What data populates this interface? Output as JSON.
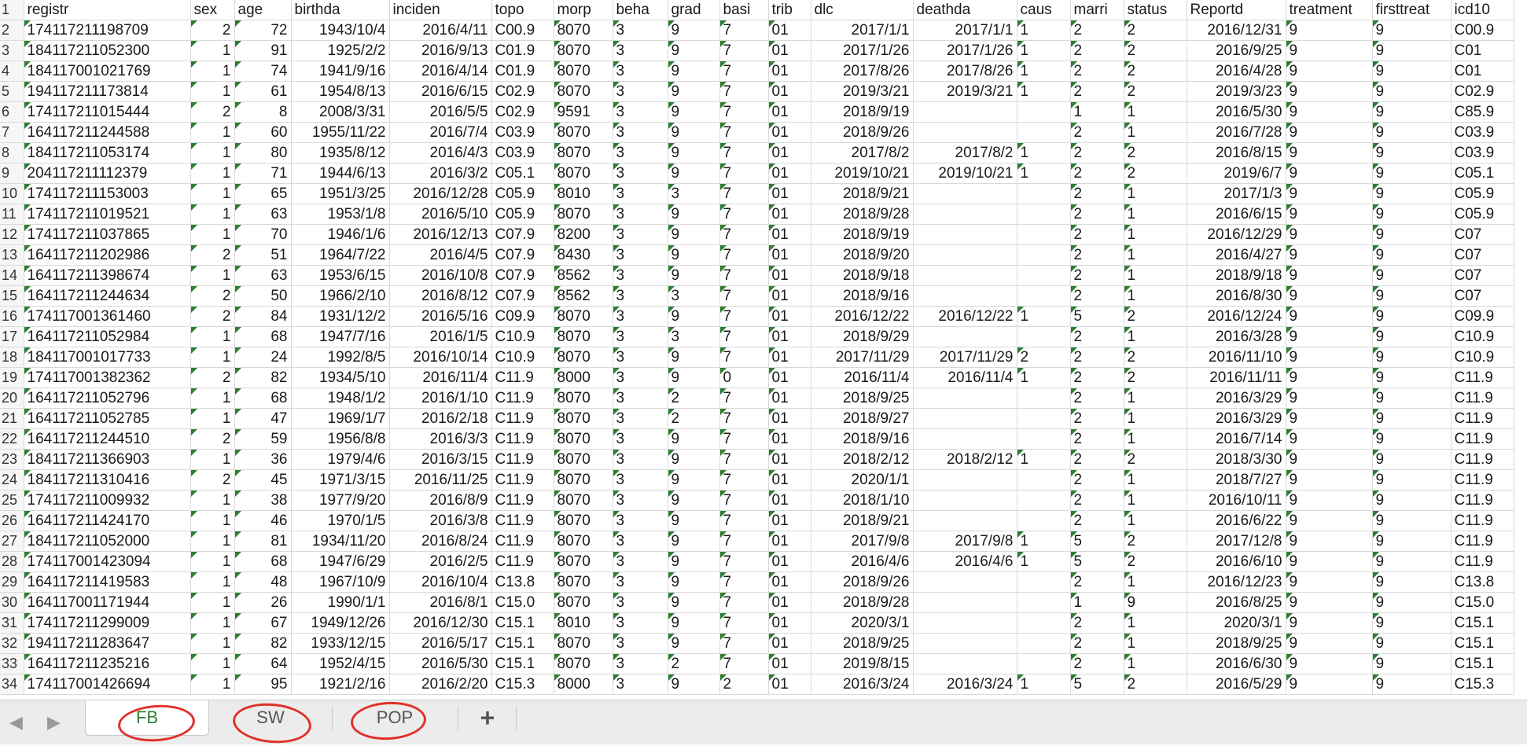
{
  "columns": [
    "registr",
    "sex",
    "age",
    "birthda",
    "inciden",
    "topo",
    "morp",
    "beha",
    "grad",
    "basi",
    "trib",
    "dlc",
    "deathda",
    "caus",
    "marri",
    "status",
    "Reportd",
    "treatment",
    "firsttreat",
    "icd10"
  ],
  "header_row_number": "1",
  "rows": [
    {
      "n": "2",
      "cells": [
        "174117211198709",
        "2",
        "72",
        "1943/10/4",
        "2016/4/11",
        "C00.9",
        "8070",
        "3",
        "9",
        "7",
        "01",
        "2017/1/1",
        "2017/1/1",
        "1",
        "2",
        "2",
        "2016/12/31",
        "9",
        "9",
        "C00.9"
      ]
    },
    {
      "n": "3",
      "cells": [
        "184117211052300",
        "1",
        "91",
        "1925/2/2",
        "2016/9/13",
        "C01.9",
        "8070",
        "3",
        "9",
        "7",
        "01",
        "2017/1/26",
        "2017/1/26",
        "1",
        "2",
        "2",
        "2016/9/25",
        "9",
        "9",
        "C01"
      ]
    },
    {
      "n": "4",
      "cells": [
        "184117001021769",
        "1",
        "74",
        "1941/9/16",
        "2016/4/14",
        "C01.9",
        "8070",
        "3",
        "9",
        "7",
        "01",
        "2017/8/26",
        "2017/8/26",
        "1",
        "2",
        "2",
        "2016/4/28",
        "9",
        "9",
        "C01"
      ]
    },
    {
      "n": "5",
      "cells": [
        "194117211173814",
        "1",
        "61",
        "1954/8/13",
        "2016/6/15",
        "C02.9",
        "8070",
        "3",
        "9",
        "7",
        "01",
        "2019/3/21",
        "2019/3/21",
        "1",
        "2",
        "2",
        "2019/3/23",
        "9",
        "9",
        "C02.9"
      ]
    },
    {
      "n": "6",
      "cells": [
        "174117211015444",
        "2",
        "8",
        "2008/3/31",
        "2016/5/5",
        "C02.9",
        "9591",
        "3",
        "9",
        "7",
        "01",
        "2018/9/19",
        "",
        "",
        "1",
        "1",
        "2016/5/30",
        "9",
        "9",
        "C85.9"
      ]
    },
    {
      "n": "7",
      "cells": [
        "164117211244588",
        "1",
        "60",
        "1955/11/22",
        "2016/7/4",
        "C03.9",
        "8070",
        "3",
        "9",
        "7",
        "01",
        "2018/9/26",
        "",
        "",
        "2",
        "1",
        "2016/7/28",
        "9",
        "9",
        "C03.9"
      ]
    },
    {
      "n": "8",
      "cells": [
        "184117211053174",
        "1",
        "80",
        "1935/8/12",
        "2016/4/3",
        "C03.9",
        "8070",
        "3",
        "9",
        "7",
        "01",
        "2017/8/2",
        "2017/8/2",
        "1",
        "2",
        "2",
        "2016/8/15",
        "9",
        "9",
        "C03.9"
      ]
    },
    {
      "n": "9",
      "cells": [
        "204117211112379",
        "1",
        "71",
        "1944/6/13",
        "2016/3/2",
        "C05.1",
        "8070",
        "3",
        "9",
        "7",
        "01",
        "2019/10/21",
        "2019/10/21",
        "1",
        "2",
        "2",
        "2019/6/7",
        "9",
        "9",
        "C05.1"
      ]
    },
    {
      "n": "10",
      "cells": [
        "174117211153003",
        "1",
        "65",
        "1951/3/25",
        "2016/12/28",
        "C05.9",
        "8010",
        "3",
        "3",
        "7",
        "01",
        "2018/9/21",
        "",
        "",
        "2",
        "1",
        "2017/1/3",
        "9",
        "9",
        "C05.9"
      ]
    },
    {
      "n": "11",
      "cells": [
        "174117211019521",
        "1",
        "63",
        "1953/1/8",
        "2016/5/10",
        "C05.9",
        "8070",
        "3",
        "9",
        "7",
        "01",
        "2018/9/28",
        "",
        "",
        "2",
        "1",
        "2016/6/15",
        "9",
        "9",
        "C05.9"
      ]
    },
    {
      "n": "12",
      "cells": [
        "174117211037865",
        "1",
        "70",
        "1946/1/6",
        "2016/12/13",
        "C07.9",
        "8200",
        "3",
        "9",
        "7",
        "01",
        "2018/9/19",
        "",
        "",
        "2",
        "1",
        "2016/12/29",
        "9",
        "9",
        "C07"
      ]
    },
    {
      "n": "13",
      "cells": [
        "164117211202986",
        "2",
        "51",
        "1964/7/22",
        "2016/4/5",
        "C07.9",
        "8430",
        "3",
        "9",
        "7",
        "01",
        "2018/9/20",
        "",
        "",
        "2",
        "1",
        "2016/4/27",
        "9",
        "9",
        "C07"
      ]
    },
    {
      "n": "14",
      "cells": [
        "164117211398674",
        "1",
        "63",
        "1953/6/15",
        "2016/10/8",
        "C07.9",
        "8562",
        "3",
        "9",
        "7",
        "01",
        "2018/9/18",
        "",
        "",
        "2",
        "1",
        "2018/9/18",
        "9",
        "9",
        "C07"
      ]
    },
    {
      "n": "15",
      "cells": [
        "164117211244634",
        "2",
        "50",
        "1966/2/10",
        "2016/8/12",
        "C07.9",
        "8562",
        "3",
        "3",
        "7",
        "01",
        "2018/9/16",
        "",
        "",
        "2",
        "1",
        "2016/8/30",
        "9",
        "9",
        "C07"
      ]
    },
    {
      "n": "16",
      "cells": [
        "174117001361460",
        "2",
        "84",
        "1931/12/2",
        "2016/5/16",
        "C09.9",
        "8070",
        "3",
        "9",
        "7",
        "01",
        "2016/12/22",
        "2016/12/22",
        "1",
        "5",
        "2",
        "2016/12/24",
        "9",
        "9",
        "C09.9"
      ]
    },
    {
      "n": "17",
      "cells": [
        "164117211052984",
        "1",
        "68",
        "1947/7/16",
        "2016/1/5",
        "C10.9",
        "8070",
        "3",
        "3",
        "7",
        "01",
        "2018/9/29",
        "",
        "",
        "2",
        "1",
        "2016/3/28",
        "9",
        "9",
        "C10.9"
      ]
    },
    {
      "n": "18",
      "cells": [
        "184117001017733",
        "1",
        "24",
        "1992/8/5",
        "2016/10/14",
        "C10.9",
        "8070",
        "3",
        "9",
        "7",
        "01",
        "2017/11/29",
        "2017/11/29",
        "2",
        "2",
        "2",
        "2016/11/10",
        "9",
        "9",
        "C10.9"
      ]
    },
    {
      "n": "19",
      "cells": [
        "174117001382362",
        "2",
        "82",
        "1934/5/10",
        "2016/11/4",
        "C11.9",
        "8000",
        "3",
        "9",
        "0",
        "01",
        "2016/11/4",
        "2016/11/4",
        "1",
        "2",
        "2",
        "2016/11/11",
        "9",
        "9",
        "C11.9"
      ]
    },
    {
      "n": "20",
      "cells": [
        "164117211052796",
        "1",
        "68",
        "1948/1/2",
        "2016/1/10",
        "C11.9",
        "8070",
        "3",
        "2",
        "7",
        "01",
        "2018/9/25",
        "",
        "",
        "2",
        "1",
        "2016/3/29",
        "9",
        "9",
        "C11.9"
      ]
    },
    {
      "n": "21",
      "cells": [
        "164117211052785",
        "1",
        "47",
        "1969/1/7",
        "2016/2/18",
        "C11.9",
        "8070",
        "3",
        "2",
        "7",
        "01",
        "2018/9/27",
        "",
        "",
        "2",
        "1",
        "2016/3/29",
        "9",
        "9",
        "C11.9"
      ]
    },
    {
      "n": "22",
      "cells": [
        "164117211244510",
        "2",
        "59",
        "1956/8/8",
        "2016/3/3",
        "C11.9",
        "8070",
        "3",
        "9",
        "7",
        "01",
        "2018/9/16",
        "",
        "",
        "2",
        "1",
        "2016/7/14",
        "9",
        "9",
        "C11.9"
      ]
    },
    {
      "n": "23",
      "cells": [
        "184117211366903",
        "1",
        "36",
        "1979/4/6",
        "2016/3/15",
        "C11.9",
        "8070",
        "3",
        "9",
        "7",
        "01",
        "2018/2/12",
        "2018/2/12",
        "1",
        "2",
        "2",
        "2018/3/30",
        "9",
        "9",
        "C11.9"
      ]
    },
    {
      "n": "24",
      "cells": [
        "184117211310416",
        "2",
        "45",
        "1971/3/15",
        "2016/11/25",
        "C11.9",
        "8070",
        "3",
        "9",
        "7",
        "01",
        "2020/1/1",
        "",
        "",
        "2",
        "1",
        "2018/7/27",
        "9",
        "9",
        "C11.9"
      ]
    },
    {
      "n": "25",
      "cells": [
        "174117211009932",
        "1",
        "38",
        "1977/9/20",
        "2016/8/9",
        "C11.9",
        "8070",
        "3",
        "9",
        "7",
        "01",
        "2018/1/10",
        "",
        "",
        "2",
        "1",
        "2016/10/11",
        "9",
        "9",
        "C11.9"
      ]
    },
    {
      "n": "26",
      "cells": [
        "164117211424170",
        "1",
        "46",
        "1970/1/5",
        "2016/3/8",
        "C11.9",
        "8070",
        "3",
        "9",
        "7",
        "01",
        "2018/9/21",
        "",
        "",
        "2",
        "1",
        "2016/6/22",
        "9",
        "9",
        "C11.9"
      ]
    },
    {
      "n": "27",
      "cells": [
        "184117211052000",
        "1",
        "81",
        "1934/11/20",
        "2016/8/24",
        "C11.9",
        "8070",
        "3",
        "9",
        "7",
        "01",
        "2017/9/8",
        "2017/9/8",
        "1",
        "5",
        "2",
        "2017/12/8",
        "9",
        "9",
        "C11.9"
      ]
    },
    {
      "n": "28",
      "cells": [
        "174117001423094",
        "1",
        "68",
        "1947/6/29",
        "2016/2/5",
        "C11.9",
        "8070",
        "3",
        "9",
        "7",
        "01",
        "2016/4/6",
        "2016/4/6",
        "1",
        "5",
        "2",
        "2016/6/10",
        "9",
        "9",
        "C11.9"
      ]
    },
    {
      "n": "29",
      "cells": [
        "164117211419583",
        "1",
        "48",
        "1967/10/9",
        "2016/10/4",
        "C13.8",
        "8070",
        "3",
        "9",
        "7",
        "01",
        "2018/9/26",
        "",
        "",
        "2",
        "1",
        "2016/12/23",
        "9",
        "9",
        "C13.8"
      ]
    },
    {
      "n": "30",
      "cells": [
        "164117001171944",
        "1",
        "26",
        "1990/1/1",
        "2016/8/1",
        "C15.0",
        "8070",
        "3",
        "9",
        "7",
        "01",
        "2018/9/28",
        "",
        "",
        "1",
        "9",
        "2016/8/25",
        "9",
        "9",
        "C15.0"
      ]
    },
    {
      "n": "31",
      "cells": [
        "174117211299009",
        "1",
        "67",
        "1949/12/26",
        "2016/12/30",
        "C15.1",
        "8010",
        "3",
        "9",
        "7",
        "01",
        "2020/3/1",
        "",
        "",
        "2",
        "1",
        "2020/3/1",
        "9",
        "9",
        "C15.1"
      ]
    },
    {
      "n": "32",
      "cells": [
        "194117211283647",
        "1",
        "82",
        "1933/12/15",
        "2016/5/17",
        "C15.1",
        "8070",
        "3",
        "9",
        "7",
        "01",
        "2018/9/25",
        "",
        "",
        "2",
        "1",
        "2018/9/25",
        "9",
        "9",
        "C15.1"
      ]
    },
    {
      "n": "33",
      "cells": [
        "164117211235216",
        "1",
        "64",
        "1952/4/15",
        "2016/5/30",
        "C15.1",
        "8070",
        "3",
        "2",
        "7",
        "01",
        "2019/8/15",
        "",
        "",
        "2",
        "1",
        "2016/6/30",
        "9",
        "9",
        "C15.1"
      ]
    },
    {
      "n": "34",
      "cells": [
        "174117001426694",
        "1",
        "95",
        "1921/2/16",
        "2016/2/20",
        "C15.3",
        "8000",
        "3",
        "9",
        "2",
        "01",
        "2016/3/24",
        "2016/3/24",
        "1",
        "5",
        "2",
        "2016/5/29",
        "9",
        "9",
        "C15.3"
      ]
    }
  ],
  "tabs": [
    {
      "label": "FB",
      "active": true
    },
    {
      "label": "SW",
      "active": false
    },
    {
      "label": "POP",
      "active": false
    }
  ],
  "add_sheet_label": "+",
  "nav_prev_icon": "◀",
  "nav_next_icon": "▶",
  "accent_color": "#2e7d32",
  "annotation_color": "#e0312a"
}
